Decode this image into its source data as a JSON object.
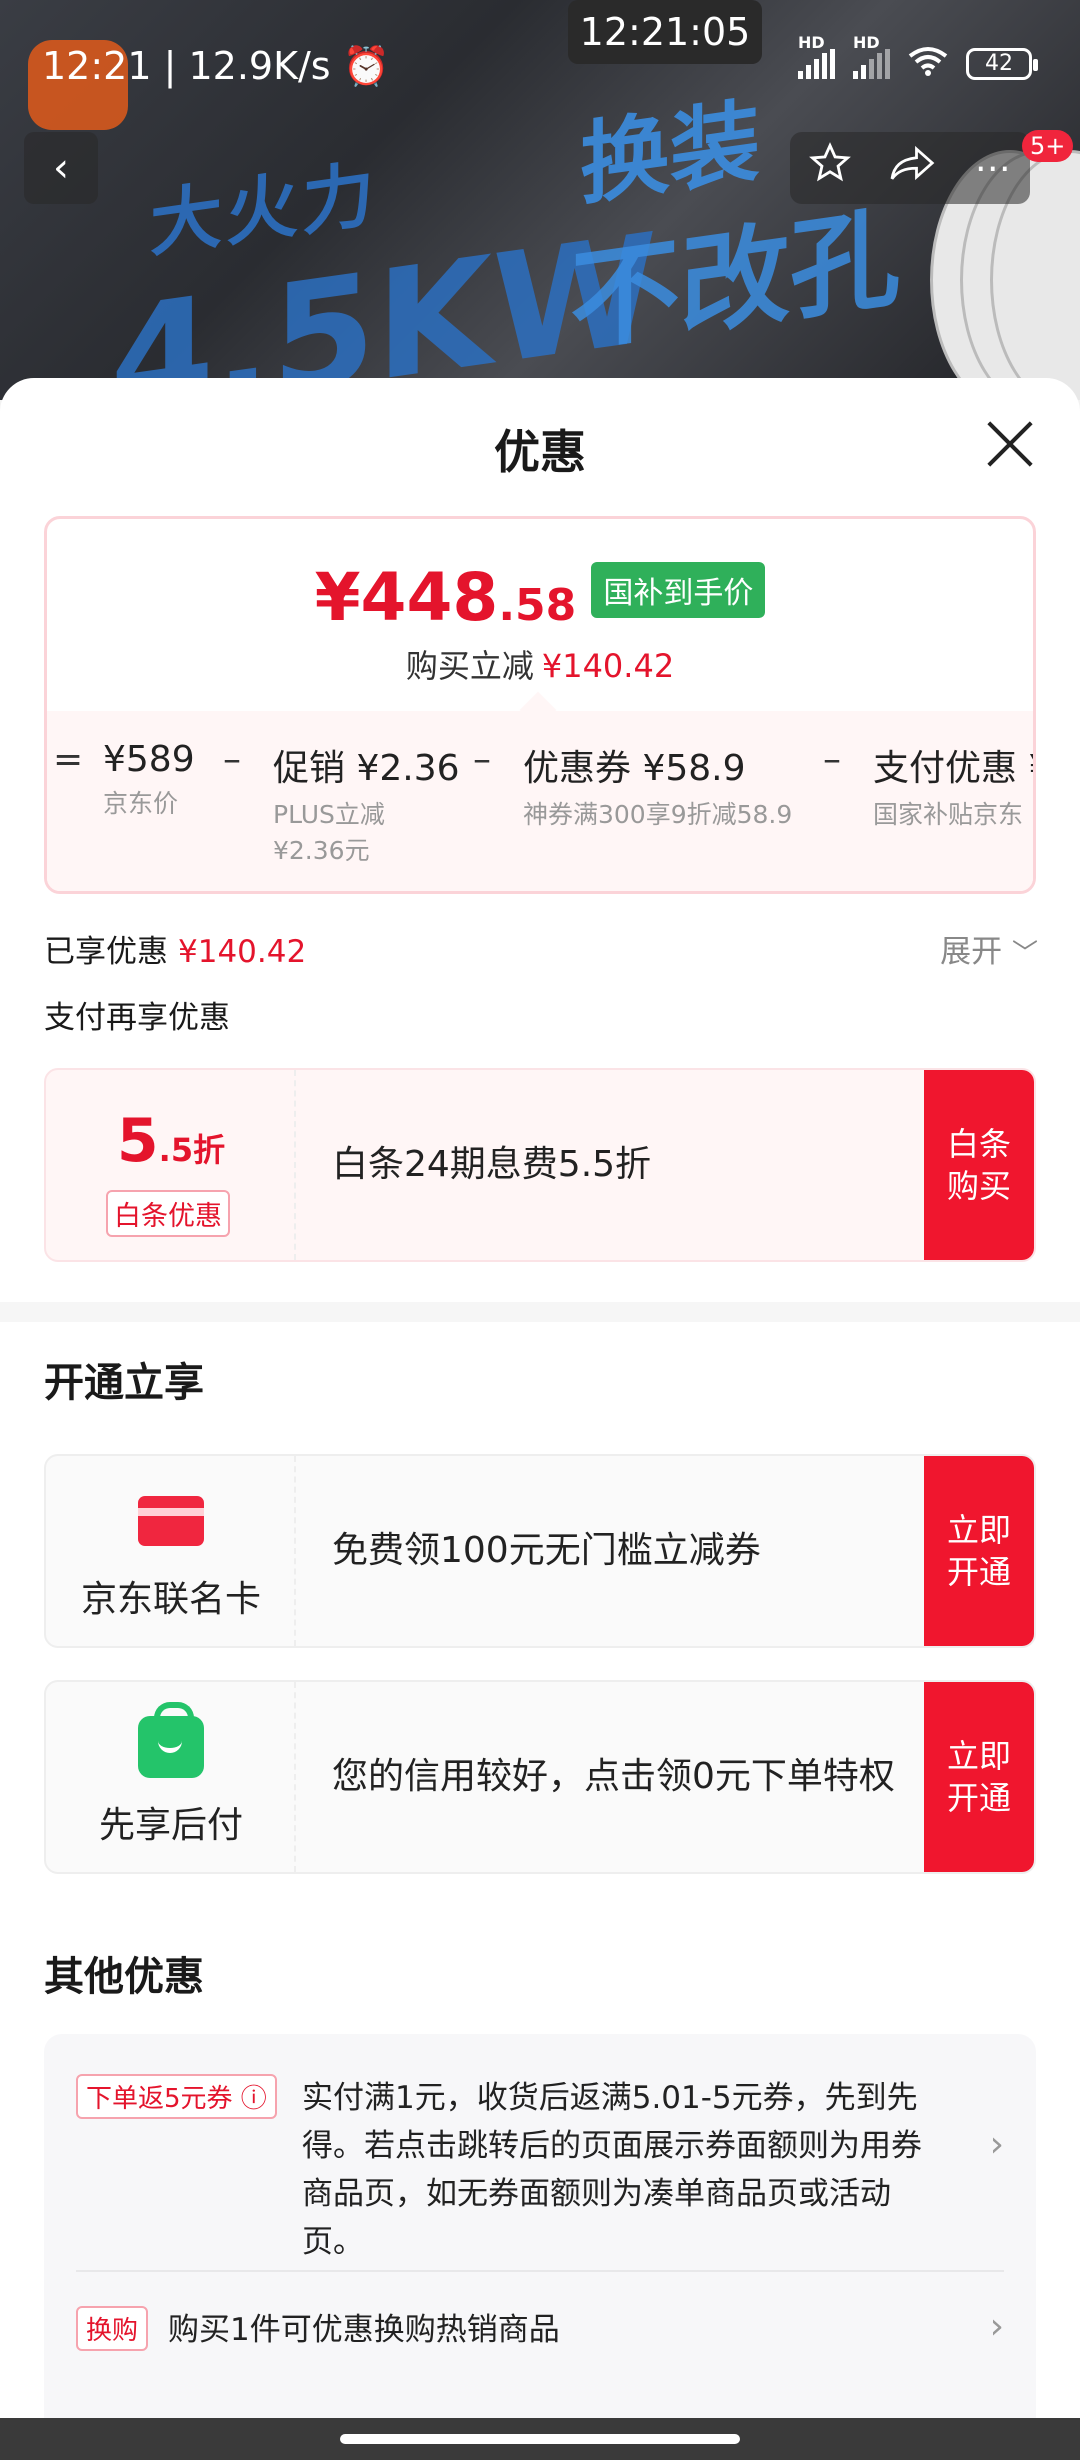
{
  "status_bar": {
    "time": "12:21 | 12.9K/s",
    "center_time": "12:21:05",
    "battery": "42",
    "hd1": "HD",
    "hd2": "HD"
  },
  "hero": {
    "decor_1": "大火力",
    "decor_2": "4.5KW",
    "decor_3": "换装",
    "decor_4": "不改孔"
  },
  "nav": {
    "back": "‹",
    "more_badge": "5+"
  },
  "sheet": {
    "title": "优惠",
    "price": {
      "symbol": "¥",
      "main": "448",
      "cents": ".58",
      "tag": "国补到手价",
      "sub_label": "购买立减",
      "sub_value": "¥140.42"
    },
    "breakdown": [
      {
        "op": "=",
        "value": "¥589",
        "desc": "京东价"
      },
      {
        "op": "–",
        "value": "促销 ¥2.36",
        "desc": "PLUS立减\n¥2.36元"
      },
      {
        "op": "–",
        "value": "优惠券 ¥58.9",
        "desc": "神券满300享9折减58.9"
      },
      {
        "op": "–",
        "value": "支付优惠 ¥",
        "desc": "国家补贴京东"
      }
    ],
    "enjoyed_label": "已享优惠",
    "enjoyed_value": "¥140.42",
    "expand": "展开",
    "pay_extra": "支付再享优惠",
    "baitiao": {
      "num": "5",
      "dec": ".5折",
      "tag": "白条优惠",
      "text": "白条24期息费5.5折",
      "cta": "白条\n购买"
    },
    "open_section": "开通立享",
    "cards": [
      {
        "name": "京东联名卡",
        "text": "免费领100元无门槛立减券",
        "cta": "立即\n开通",
        "icon": "credit-card-icon"
      },
      {
        "name": "先享后付",
        "text": "您的信用较好，点击领0元下单特权",
        "cta": "立即\n开通",
        "icon": "shopping-bag-icon"
      }
    ],
    "other_section": "其他优惠",
    "other": [
      {
        "tag": "下单返5元券 ⓘ",
        "text": "实付满1元，收货后返满5.01-5元券，先到先得。若点击跳转后的页面展示券面额则为用券商品页，如无券面额则为凑单商品页或活动页。"
      },
      {
        "tag": "换购",
        "text": "购买1件可优惠换购热销商品"
      }
    ]
  }
}
